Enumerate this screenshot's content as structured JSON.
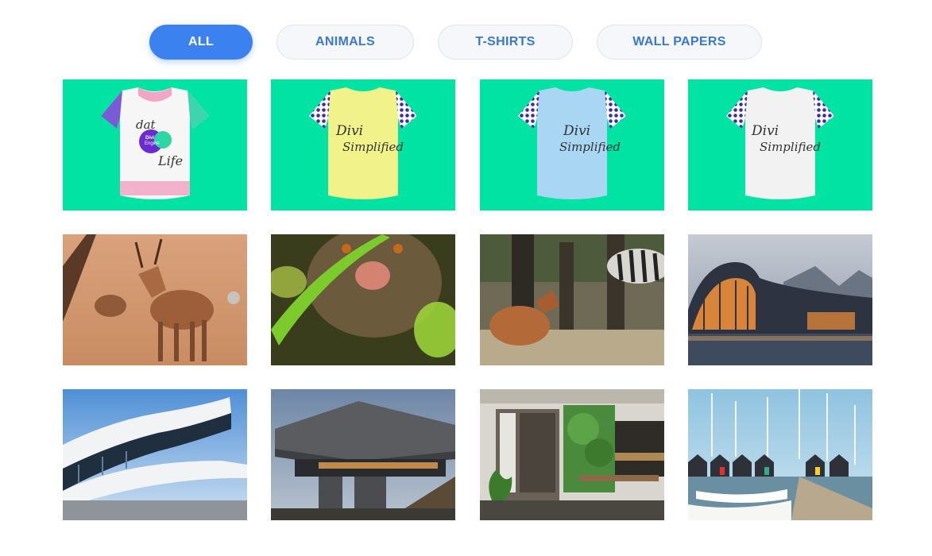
{
  "filters": [
    {
      "label": "ALL",
      "active": true
    },
    {
      "label": "ANIMALS",
      "active": false
    },
    {
      "label": "T-SHIRTS",
      "active": false
    },
    {
      "label": "WALL PAPERS",
      "active": false
    }
  ],
  "colors": {
    "accent": "#3b82f0",
    "filter_text": "#3a78c9",
    "tshirt_background": "#00e3a3"
  },
  "gallery": {
    "tshirts": [
      {
        "name": "t-shirt-dat-divi-life",
        "body_color": "#f6f6f6",
        "lines": [
          "dat",
          "Divi",
          "Engine",
          "Life"
        ]
      },
      {
        "name": "t-shirt-yellow",
        "body_color": "#f2f28a",
        "lines": [
          "Divi",
          "Simplified"
        ]
      },
      {
        "name": "t-shirt-blue",
        "body_color": "#a9d6f2",
        "lines": [
          "Divi",
          "Simplified"
        ]
      },
      {
        "name": "t-shirt-white",
        "body_color": "#f2f2f2",
        "lines": [
          "Divi",
          "Simplified"
        ]
      }
    ]
  }
}
